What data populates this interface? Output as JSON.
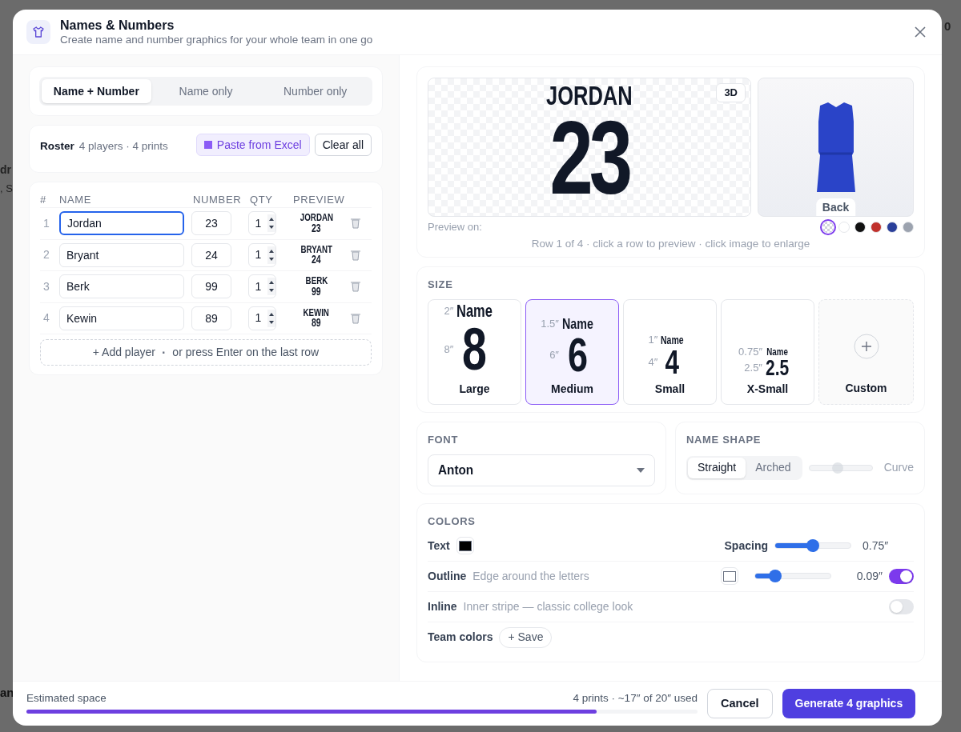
{
  "background_fragments": [
    {
      "text": "dr",
      "kind": "heading"
    },
    {
      "text": ", S",
      "kind": "muted"
    },
    {
      "text": "0",
      "kind": "corner"
    },
    {
      "text": "an",
      "kind": "footer"
    }
  ],
  "dialog": {
    "title": "Names & Numbers",
    "subtitle": "Create name and number graphics for your whole team in one go"
  },
  "mode_tabs": [
    {
      "label": "Name + Number",
      "selected": true
    },
    {
      "label": "Name only",
      "selected": false
    },
    {
      "label": "Number only",
      "selected": false
    }
  ],
  "roster": {
    "title": "Roster",
    "summary": "4 players · 4 prints",
    "paste_button": "Paste from Excel",
    "clear_button": "Clear all"
  },
  "table": {
    "columns": [
      "#",
      "NAME",
      "NUMBER",
      "QTY",
      "PREVIEW"
    ],
    "rows": [
      {
        "index": "1",
        "name": "Jordan",
        "number": "23",
        "qty": "1",
        "focused": true,
        "preview_name": "JORDAN",
        "preview_number": "23"
      },
      {
        "index": "2",
        "name": "Bryant",
        "number": "24",
        "qty": "1",
        "focused": false,
        "preview_name": "BRYANT",
        "preview_number": "24"
      },
      {
        "index": "3",
        "name": "Berk",
        "number": "99",
        "qty": "1",
        "focused": false,
        "preview_name": "BERK",
        "preview_number": "99"
      },
      {
        "index": "4",
        "name": "Kewin",
        "number": "89",
        "qty": "1",
        "focused": false,
        "preview_name": "KEWIN",
        "preview_number": "89"
      }
    ],
    "add_button": "+ Add player",
    "add_separator": "·",
    "add_hint": "or press Enter on the last row"
  },
  "preview": {
    "name": "JORDAN",
    "number": "23",
    "view_button": "3D",
    "jersey_label": "Back",
    "preview_on_label": "Preview on:",
    "hint": "Row 1 of 4 · click a row to preview · click image to enlarge",
    "swatches": [
      {
        "kind": "transparent",
        "selected": true
      },
      {
        "kind": "solid",
        "color": "#ffffff",
        "selected": false
      },
      {
        "kind": "solid",
        "color": "#111111",
        "selected": false
      },
      {
        "kind": "solid",
        "color": "#c0302b",
        "selected": false
      },
      {
        "kind": "solid",
        "color": "#2a3f9a",
        "selected": false
      },
      {
        "kind": "solid",
        "color": "#9ca3af",
        "selected": false
      }
    ]
  },
  "size": {
    "title": "SIZE",
    "options": [
      {
        "kind": "preset",
        "label": "Large",
        "name_height": "2″",
        "number_height": "8″",
        "number": "8",
        "sample": "Name",
        "selected": false
      },
      {
        "kind": "preset",
        "label": "Medium",
        "name_height": "1.5″",
        "number_height": "6″",
        "number": "6",
        "sample": "Name",
        "selected": true
      },
      {
        "kind": "preset",
        "label": "Small",
        "name_height": "1″",
        "number_height": "4″",
        "number": "4",
        "sample": "Name",
        "selected": false
      },
      {
        "kind": "preset",
        "label": "X-Small",
        "name_height": "0.75″",
        "number_height": "2.5″",
        "number": "2.5",
        "sample": "Name",
        "selected": false
      },
      {
        "kind": "custom",
        "label": "Custom",
        "selected": false
      }
    ]
  },
  "font": {
    "title": "FONT",
    "value": "Anton"
  },
  "name_shape": {
    "title": "NAME SHAPE",
    "options": [
      {
        "label": "Straight",
        "selected": true
      },
      {
        "label": "Arched",
        "selected": false
      }
    ],
    "curve": {
      "label": "Curve",
      "level": 0.45,
      "disabled": true
    }
  },
  "colors": {
    "title": "COLORS",
    "rows": [
      {
        "kind": "text",
        "label": "Text",
        "color": "#000000",
        "slider_label": "Spacing",
        "level": 0.5,
        "value": "0.75″"
      },
      {
        "kind": "toggle_slider",
        "label": "Outline",
        "hint": "Edge around the letters",
        "color": "#ffffff",
        "level": 0.27,
        "value": "0.09″",
        "on": true
      },
      {
        "kind": "toggle",
        "label": "Inline",
        "hint": "Inner stripe — classic college look",
        "on": false
      },
      {
        "kind": "action",
        "label": "Team colors",
        "button": "+ Save"
      }
    ]
  },
  "footer": {
    "label": "Estimated space",
    "summary": "4 prints · ~17″ of 20″ used",
    "level": 0.85,
    "cancel": "Cancel",
    "submit": "Generate 4 graphics"
  }
}
